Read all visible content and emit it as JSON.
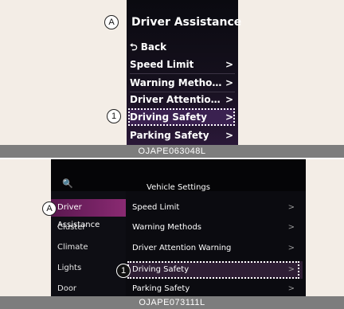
{
  "panel_top": {
    "screen": {
      "title": "Driver Assistance",
      "back_label": "⮌ Back",
      "items": [
        {
          "label": "Speed Limit",
          "chevron": ">"
        },
        {
          "label": "Warning Methods",
          "chevron": ">"
        },
        {
          "label": "Driver Attention...",
          "chevron": ">"
        },
        {
          "label": "Driving Safety",
          "chevron": ">"
        },
        {
          "label": "Parking Safety",
          "chevron": ">"
        }
      ]
    },
    "callouts": {
      "a": "A",
      "one": "1"
    },
    "caption": "OJAPE063048L"
  },
  "panel_bottom": {
    "screen": {
      "search_icon": "🔍",
      "title": "Vehicle Settings",
      "sidebar": [
        "Driver Assistance",
        "Cluster",
        "Climate",
        "Lights",
        "Door"
      ],
      "items": [
        {
          "label": "Speed Limit",
          "chevron": ">"
        },
        {
          "label": "Warning Methods",
          "chevron": ">"
        },
        {
          "label": "Driver Attention Warning",
          "chevron": ">"
        },
        {
          "label": "Driving Safety",
          "chevron": ">"
        },
        {
          "label": "Parking Safety",
          "chevron": ">"
        }
      ]
    },
    "callouts": {
      "a": "A",
      "one": "1"
    },
    "caption": "OJAPE073111L"
  },
  "colors": {
    "accent_active": "#8a2a72",
    "background": "#f3ede6",
    "caption_bar": "#7d7d7d"
  }
}
